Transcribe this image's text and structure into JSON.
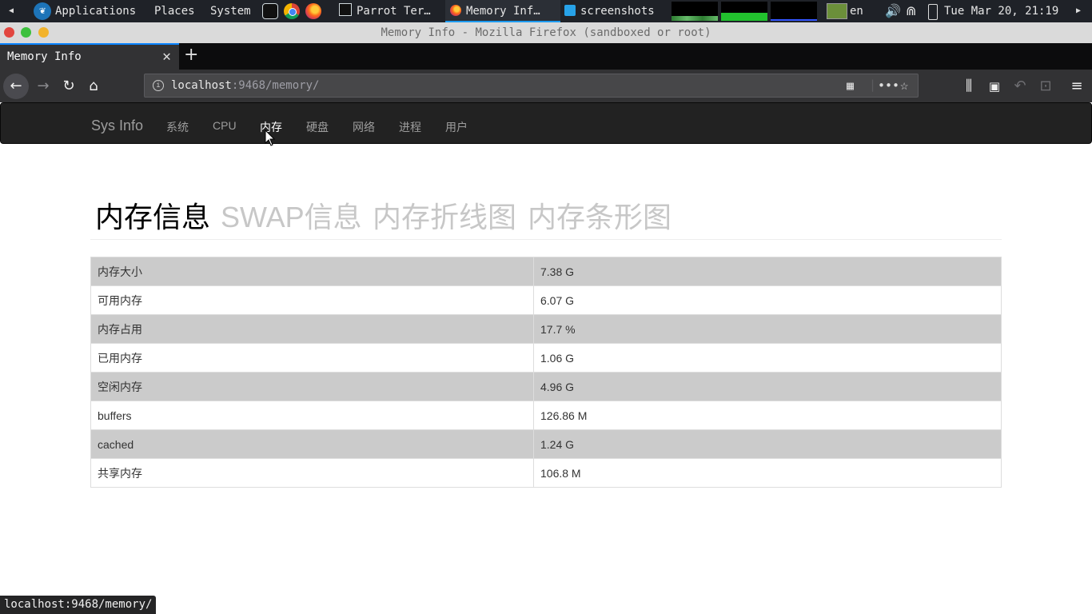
{
  "desktop_panel": {
    "menus": [
      "Applications",
      "Places",
      "System"
    ],
    "tasks": [
      {
        "label": "Parrot Ter…",
        "icon": "terminal-icon"
      },
      {
        "label": "Memory Inf…",
        "icon": "firefox-icon",
        "active": true
      },
      {
        "label": "screenshots",
        "icon": "folder-icon"
      }
    ],
    "keyboard_layout": "en",
    "clock": "Tue Mar 20, 21:19"
  },
  "window": {
    "title": "Memory Info - Mozilla Firefox (sandboxed or root)"
  },
  "browser": {
    "tab_title": "Memory Info",
    "url_host": "localhost",
    "url_rest": ":9468/memory/",
    "status_url": "localhost:9468/memory/"
  },
  "site_nav": {
    "brand": "Sys Info",
    "links": [
      "系统",
      "CPU",
      "内存",
      "硬盘",
      "网络",
      "进程",
      "用户"
    ],
    "active_index": 2
  },
  "heading_tabs": [
    "内存信息",
    "SWAP信息",
    "内存折线图",
    "内存条形图"
  ],
  "memory_table": [
    {
      "key": "内存大小",
      "value": "7.38 G"
    },
    {
      "key": "可用内存",
      "value": "6.07 G"
    },
    {
      "key": "内存占用",
      "value": "17.7 %"
    },
    {
      "key": "已用内存",
      "value": "1.06 G"
    },
    {
      "key": "空闲内存",
      "value": "4.96 G"
    },
    {
      "key": "buffers",
      "value": "126.86 M"
    },
    {
      "key": "cached",
      "value": "1.24 G"
    },
    {
      "key": "共享内存",
      "value": "106.8 M"
    }
  ],
  "colors": {
    "navbar_bg": "#222222",
    "table_stripe": "#cbcbcb",
    "accent": "#0a84ff"
  }
}
